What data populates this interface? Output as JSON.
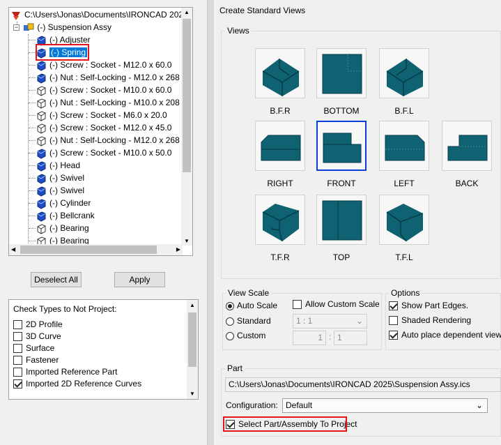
{
  "tree": {
    "root_path": "C:\\Users\\Jonas\\Documents\\IRONCAD 202",
    "assembly_label": "(-) Suspension Assy",
    "items": [
      {
        "label": "(-) Adjuster"
      },
      {
        "label": "(-) Spring"
      },
      {
        "label": "(-) Screw : Socket - M12.0 x 60.0"
      },
      {
        "label": "(-) Nut : Self-Locking - M12.0 x 268"
      },
      {
        "label": "(-) Screw : Socket - M10.0 x 60.0"
      },
      {
        "label": "(-) Nut : Self-Locking - M10.0 x 208"
      },
      {
        "label": "(-) Screw : Socket - M6.0 x 20.0"
      },
      {
        "label": "(-) Screw : Socket - M12.0 x 45.0"
      },
      {
        "label": "(-) Nut : Self-Locking - M12.0 x 268"
      },
      {
        "label": "(-) Screw : Socket - M10.0 x 50.0"
      },
      {
        "label": "(-) Head"
      },
      {
        "label": "(-) Swivel"
      },
      {
        "label": "(-) Swivel"
      },
      {
        "label": "(-) Cylinder"
      },
      {
        "label": "(-) Bellcrank"
      },
      {
        "label": "(-) Bearing"
      },
      {
        "label": "(-) Bearing"
      }
    ]
  },
  "buttons": {
    "deselect_all": "Deselect All",
    "apply": "Apply"
  },
  "check_types": {
    "title": "Check Types to Not Project:",
    "items": [
      {
        "label": "2D Profile",
        "checked": false
      },
      {
        "label": "3D Curve",
        "checked": false
      },
      {
        "label": "Surface",
        "checked": false
      },
      {
        "label": "Fastener",
        "checked": false
      },
      {
        "label": "Imported Reference Part",
        "checked": false
      },
      {
        "label": "Imported 2D Reference Curves",
        "checked": true
      }
    ]
  },
  "panel": {
    "title": "Create Standard Views",
    "views_group": "Views",
    "views": [
      {
        "label": "B.F.R"
      },
      {
        "label": "BOTTOM"
      },
      {
        "label": "B.F.L"
      },
      {
        "label": "RIGHT"
      },
      {
        "label": "FRONT"
      },
      {
        "label": "LEFT"
      },
      {
        "label": "BACK"
      },
      {
        "label": "T.F.R"
      },
      {
        "label": "TOP"
      },
      {
        "label": "T.F.L"
      }
    ],
    "selected_view": "FRONT",
    "view_scale": {
      "title": "View Scale",
      "auto": "Auto Scale",
      "standard": "Standard",
      "custom": "Custom",
      "selected": "Auto Scale",
      "allow_custom_label": "Allow Custom Scale",
      "allow_custom_checked": false,
      "standard_value": "1 : 1",
      "custom_left": "1",
      "custom_right": "1"
    },
    "options": {
      "title": "Options",
      "show_edges": "Show Part Edges.",
      "show_edges_checked": true,
      "shaded": "Shaded Rendering",
      "shaded_checked": false,
      "auto_place": "Auto place dependent views.",
      "auto_place_checked": true
    },
    "part": {
      "title": "Part",
      "path": "C:\\Users\\Jonas\\Documents\\IRONCAD 2025\\Suspension Assy.ics",
      "config_label": "Configuration:",
      "config_value": "Default",
      "select_label": "Select Part/Assembly To Project",
      "select_checked": true
    }
  },
  "colors": {
    "part_fill": "#0e6272",
    "highlight": "#0078d7",
    "red_annotation": "#e3141b",
    "selected_border": "#0a3cd8"
  }
}
